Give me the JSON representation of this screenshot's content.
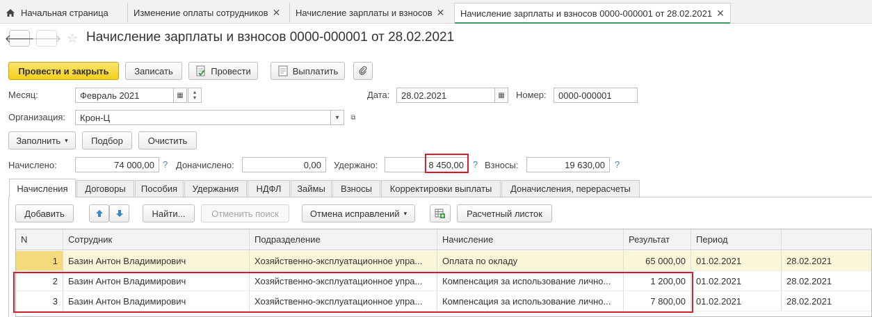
{
  "tabs": [
    {
      "label": "Начальная страница"
    },
    {
      "label": "Изменение оплаты сотрудников"
    },
    {
      "label": "Начисление зарплаты и взносов"
    },
    {
      "label": "Начисление зарплаты и взносов 0000-000001 от 28.02.2021"
    }
  ],
  "document": {
    "title": "Начисление зарплаты и взносов 0000-000001 от 28.02.2021"
  },
  "toolbar": {
    "post_close": "Провести и закрыть",
    "save": "Записать",
    "post": "Провести",
    "pay": "Выплатить"
  },
  "fields": {
    "month_label": "Месяц:",
    "month_value": "Февраль 2021",
    "date_label": "Дата:",
    "date_value": "28.02.2021",
    "number_label": "Номер:",
    "number_value": "0000-000001",
    "org_label": "Организация:",
    "org_value": "Крон-Ц"
  },
  "actions": {
    "fill": "Заполнить",
    "select": "Подбор",
    "clear": "Очистить"
  },
  "totals": {
    "accrued_label": "Начислено:",
    "accrued_value": "74 000,00",
    "extra_label": "Доначислено:",
    "extra_value": "0,00",
    "withheld_label": "Удержано:",
    "withheld_value": "8 450,00",
    "contrib_label": "Взносы:",
    "contrib_value": "19 630,00",
    "help_mark": "?"
  },
  "form_tabs": [
    {
      "label": "Начисления"
    },
    {
      "label": "Договоры"
    },
    {
      "label": "Пособия"
    },
    {
      "label": "Удержания"
    },
    {
      "label": "НДФЛ"
    },
    {
      "label": "Займы"
    },
    {
      "label": "Взносы"
    },
    {
      "label": "Корректировки выплаты"
    },
    {
      "label": "Доначисления, перерасчеты"
    }
  ],
  "table_toolbar": {
    "add": "Добавить",
    "find": "Найти...",
    "cancel_search": "Отменить поиск",
    "cancel_corrections": "Отмена исправлений",
    "payslip": "Расчетный листок"
  },
  "table": {
    "columns": [
      "N",
      "Сотрудник",
      "Подразделение",
      "Начисление",
      "Результат",
      "Период",
      ""
    ],
    "rows": [
      [
        "1",
        "Базин Антон Владимирович",
        "Хозяйственно-эксплуатационное упра...",
        "Оплата по окладу",
        "65 000,00",
        "01.02.2021",
        "28.02.2021"
      ],
      [
        "2",
        "Базин Антон Владимирович",
        "Хозяйственно-эксплуатационное упра...",
        "Компенсация за использование лично...",
        "1 200,00",
        "01.02.2021",
        "28.02.2021"
      ],
      [
        "3",
        "Базин Антон Владимирович",
        "Хозяйственно-эксплуатационное упра...",
        "Компенсация за использование лично...",
        "7 800,00",
        "01.02.2021",
        "28.02.2021"
      ]
    ]
  },
  "colors": {
    "primary_button": "#f3d01b",
    "active_tab_underline": "#3d9e67",
    "highlight_box": "#d21f2b",
    "selected_row": "#fbf6d8"
  }
}
